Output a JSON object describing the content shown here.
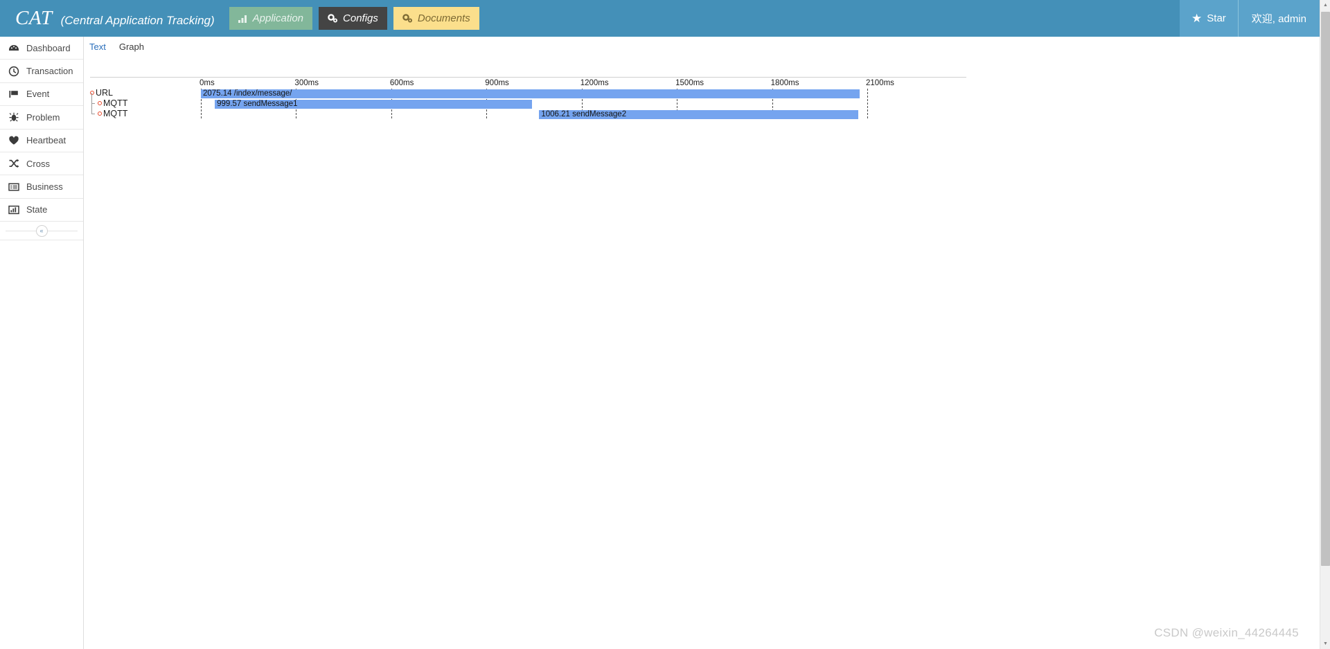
{
  "header": {
    "brand": "CAT",
    "brand_sub": "(Central Application Tracking)",
    "nav": [
      {
        "label": "Application",
        "icon": "bar-chart-icon",
        "bg": "#82b79a",
        "fg": "#e8f2ec"
      },
      {
        "label": "Configs",
        "icon": "gears-icon",
        "bg": "#444444",
        "fg": "#ffffff"
      },
      {
        "label": "Documents",
        "icon": "gears-icon",
        "bg": "#fbdf8c",
        "fg": "#7d6a33"
      }
    ],
    "star_label": "Star",
    "star_icon": "star-icon",
    "user_label": "欢迎, admin",
    "bg": "#4490b8"
  },
  "sidebar": {
    "items": [
      {
        "label": "Dashboard",
        "icon": "dashboard-icon"
      },
      {
        "label": "Transaction",
        "icon": "clock-icon"
      },
      {
        "label": "Event",
        "icon": "flag-icon"
      },
      {
        "label": "Problem",
        "icon": "bug-icon"
      },
      {
        "label": "Heartbeat",
        "icon": "heart-icon"
      },
      {
        "label": "Cross",
        "icon": "shuffle-icon"
      },
      {
        "label": "Business",
        "icon": "list-icon"
      },
      {
        "label": "State",
        "icon": "bar-chart-icon"
      }
    ],
    "collapse_icon": "chevron-double-left-icon"
  },
  "tabs": {
    "text": "Text",
    "graph": "Graph",
    "active": "Text"
  },
  "chart_data": {
    "type": "bar",
    "orientation": "horizontal",
    "title": "",
    "xlabel": "",
    "ylabel": "",
    "unit": "ms",
    "xlim": [
      0,
      2160
    ],
    "grid": true,
    "legend": false,
    "tick_labels": [
      "0ms",
      "300ms",
      "600ms",
      "900ms",
      "1200ms",
      "1500ms",
      "1800ms",
      "2100ms"
    ],
    "tick_values": [
      0,
      300,
      600,
      900,
      1200,
      1500,
      1800,
      2100
    ],
    "categories": [
      "URL",
      "MQTT",
      "MQTT"
    ],
    "bars": [
      {
        "type": "URL",
        "label": "2075.14 /index/message/",
        "duration": 2075.14,
        "start": 0,
        "depth": 0,
        "color": "#75a4ef"
      },
      {
        "type": "MQTT",
        "label": "999.57 sendMessage1",
        "duration": 999.57,
        "start": 44,
        "depth": 1,
        "color": "#75a4ef"
      },
      {
        "type": "MQTT",
        "label": "1006.21 sendMessage2",
        "duration": 1006.21,
        "start": 1066,
        "depth": 1,
        "color": "#75a4ef"
      }
    ]
  },
  "watermark": "CSDN @weixin_44264445"
}
